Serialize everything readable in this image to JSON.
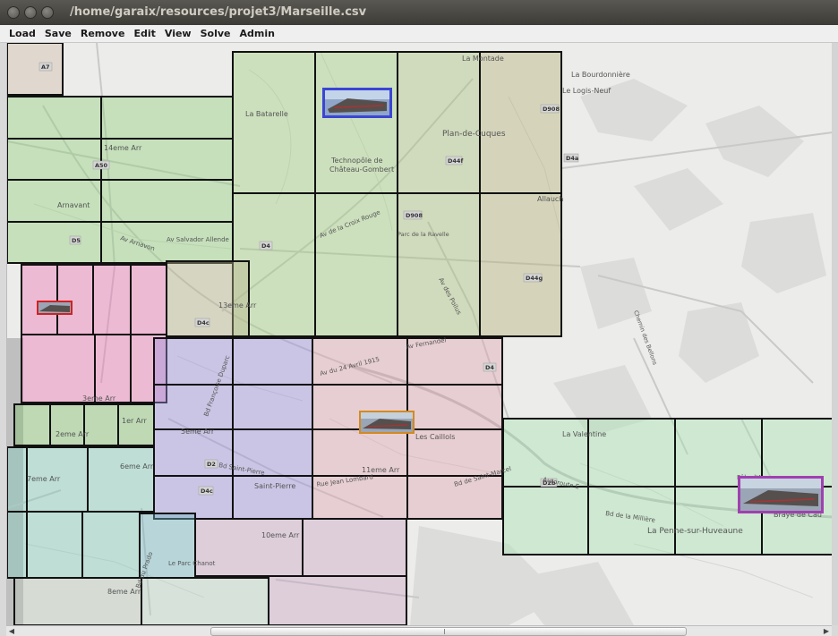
{
  "window": {
    "title": "/home/garaix/resources/projet3/Marseille.csv"
  },
  "menu": [
    "Load",
    "Save",
    "Remove",
    "Edit",
    "View",
    "Solve",
    "Admin"
  ],
  "map": {
    "place_labels": [
      "La Batarelle",
      "Technopôle de",
      "Château-Gombert",
      "Plan-de-Cuques",
      "La Montade",
      "La Bourdonnière",
      "Le Logis-Neuf",
      "Allauch",
      "14eme Arr",
      "Arnavant",
      "13eme Arr",
      "3eme Arr",
      "2eme Arr",
      "1er Arr",
      "5eme Arr",
      "6eme Arr",
      "7eme Arr",
      "Saint-Pierre",
      "11eme Arr",
      "Les Caillols",
      "La Valentine",
      "La Penne-sur-Huveaune",
      "10eme Arr",
      "8eme Arr",
      "Le Parc Chanot",
      "Pôle d'Ac",
      "Braye de Cau",
      "Parc de la Ravelle",
      "Chemin des Bellons"
    ],
    "road_labels": [
      "Av de la Croix Rouge",
      "Av du 24 Avril 1915",
      "Av Salvador Allende",
      "Av Arnavon",
      "Autoroute E",
      "Bd de la Millière",
      "Av des Poilus",
      "Bd Françoise Duparc",
      "Bd de Saint-Marcel",
      "Av Fernandel",
      "Rue Jean Lombard",
      "Bd Saint-Pierre",
      "Bd du Prado"
    ],
    "road_numbers": [
      "D908",
      "D44f",
      "D4a",
      "D4",
      "D44g",
      "D908",
      "D4c",
      "D2",
      "D2b",
      "D4",
      "D4c",
      "D5",
      "A7",
      "A50"
    ],
    "zone_colors": {
      "green": "#8fcf7a",
      "olive": "#b5b37a",
      "light_green": "#a7d993",
      "pink": "#ee74b6",
      "rose": "#e1a4b0",
      "purple": "#9a8fdc",
      "teal": "#7fcaba",
      "mauve": "#c8a4c4",
      "grey_green": "#b8c4b4",
      "mint": "#a6e3b0",
      "tan": "#cfb9a8"
    },
    "markers": [
      {
        "name": "depot-chateau-gombert",
        "border": "#3b45d4"
      },
      {
        "name": "depot-3eme",
        "border": "#d42020"
      },
      {
        "name": "depot-caillols",
        "border": "#d48a20"
      },
      {
        "name": "depot-la-penne",
        "border": "#a040b0"
      }
    ]
  }
}
